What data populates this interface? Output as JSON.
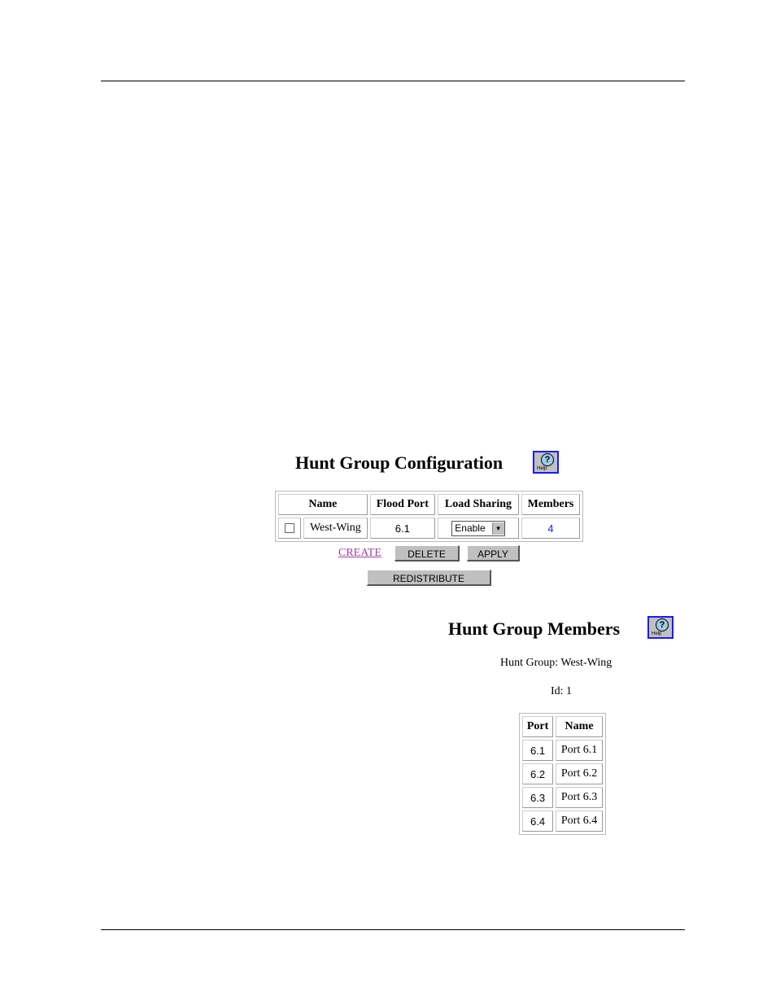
{
  "config": {
    "title": "Hunt Group Configuration",
    "help_label": "Help",
    "columns": [
      "Name",
      "Flood Port",
      "Load Sharing",
      "Members"
    ],
    "row": {
      "name": "West-Wing",
      "flood_port": "6.1",
      "load_sharing": "Enable",
      "members": "4"
    },
    "buttons": {
      "create": "CREATE",
      "delete": "DELETE",
      "apply": "APPLY",
      "redistribute": "REDISTRIBUTE"
    }
  },
  "members": {
    "title": "Hunt Group Members",
    "help_label": "Help",
    "hunt_group": "Hunt Group: West-Wing",
    "id": "Id: 1",
    "columns": [
      "Port",
      "Name"
    ],
    "rows": [
      {
        "port": "6.1",
        "name": "Port 6.1"
      },
      {
        "port": "6.2",
        "name": "Port 6.2"
      },
      {
        "port": "6.3",
        "name": "Port 6.3"
      },
      {
        "port": "6.4",
        "name": "Port 6.4"
      }
    ]
  }
}
